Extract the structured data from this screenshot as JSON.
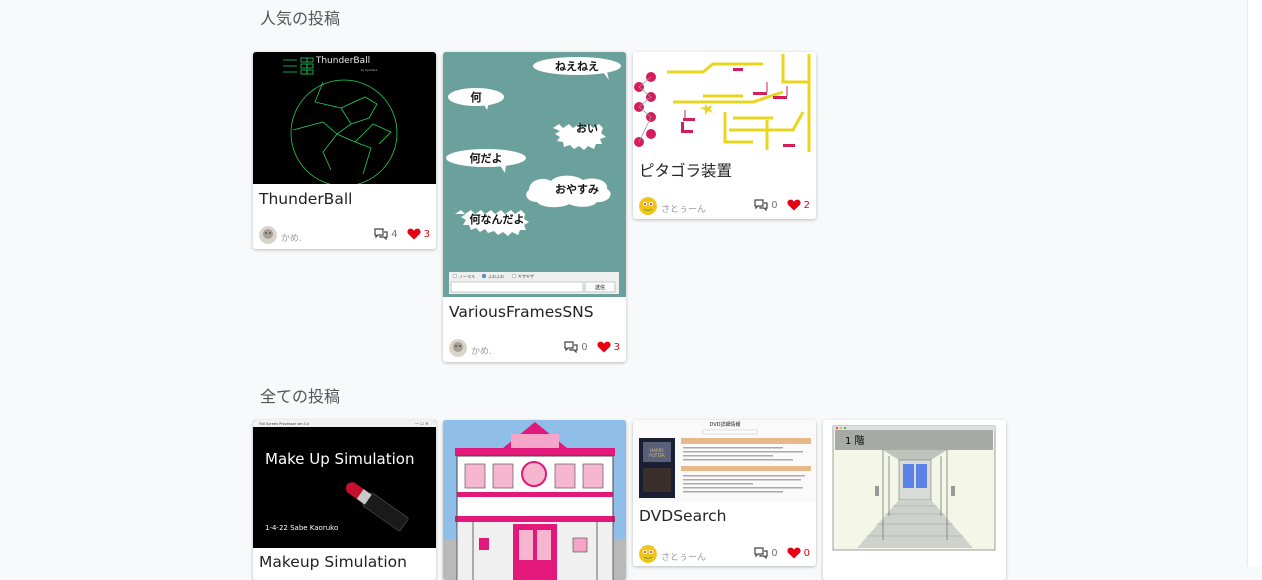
{
  "sections": {
    "popular": "人気の投稿",
    "all": "全ての投稿"
  },
  "colors": {
    "like": "#e60012",
    "accent_pink": "#d41d5c"
  },
  "popular_posts": [
    {
      "title": "ThunderBall",
      "author": "かめ.",
      "comments": "4",
      "likes": "3",
      "thumb": {
        "title": "ThunderBall",
        "sub": "by Kyohara"
      }
    },
    {
      "title": "VariousFramesSNS",
      "author": "かめ.",
      "comments": "0",
      "likes": "3",
      "thumb": {
        "bubbles": [
          "ねえねえ",
          "何",
          "おい",
          "何だよ",
          "おやすみ",
          "何なんだよ"
        ],
        "radios": [
          "ノーマル",
          "ふわふわ",
          "ギザギザ"
        ],
        "send": "送信"
      }
    },
    {
      "title": "ピタゴラ装置",
      "author": "さとぅーん",
      "comments": "0",
      "likes": "2"
    }
  ],
  "all_posts": [
    {
      "title": "Makeup Simulation",
      "thumb": {
        "window_title": "Full Screen Processor ver.3.4",
        "heading": "Make Up Simulation",
        "caption": "1-4-22 Sabe Kaoruko"
      }
    },
    {
      "title": ""
    },
    {
      "title": "DVDSearch",
      "author": "さとぅーん",
      "comments": "0",
      "likes": "0",
      "thumb": {
        "heading": "DVD詳細情報"
      }
    },
    {
      "title": "",
      "thumb": {
        "floor": "1 階"
      }
    }
  ]
}
